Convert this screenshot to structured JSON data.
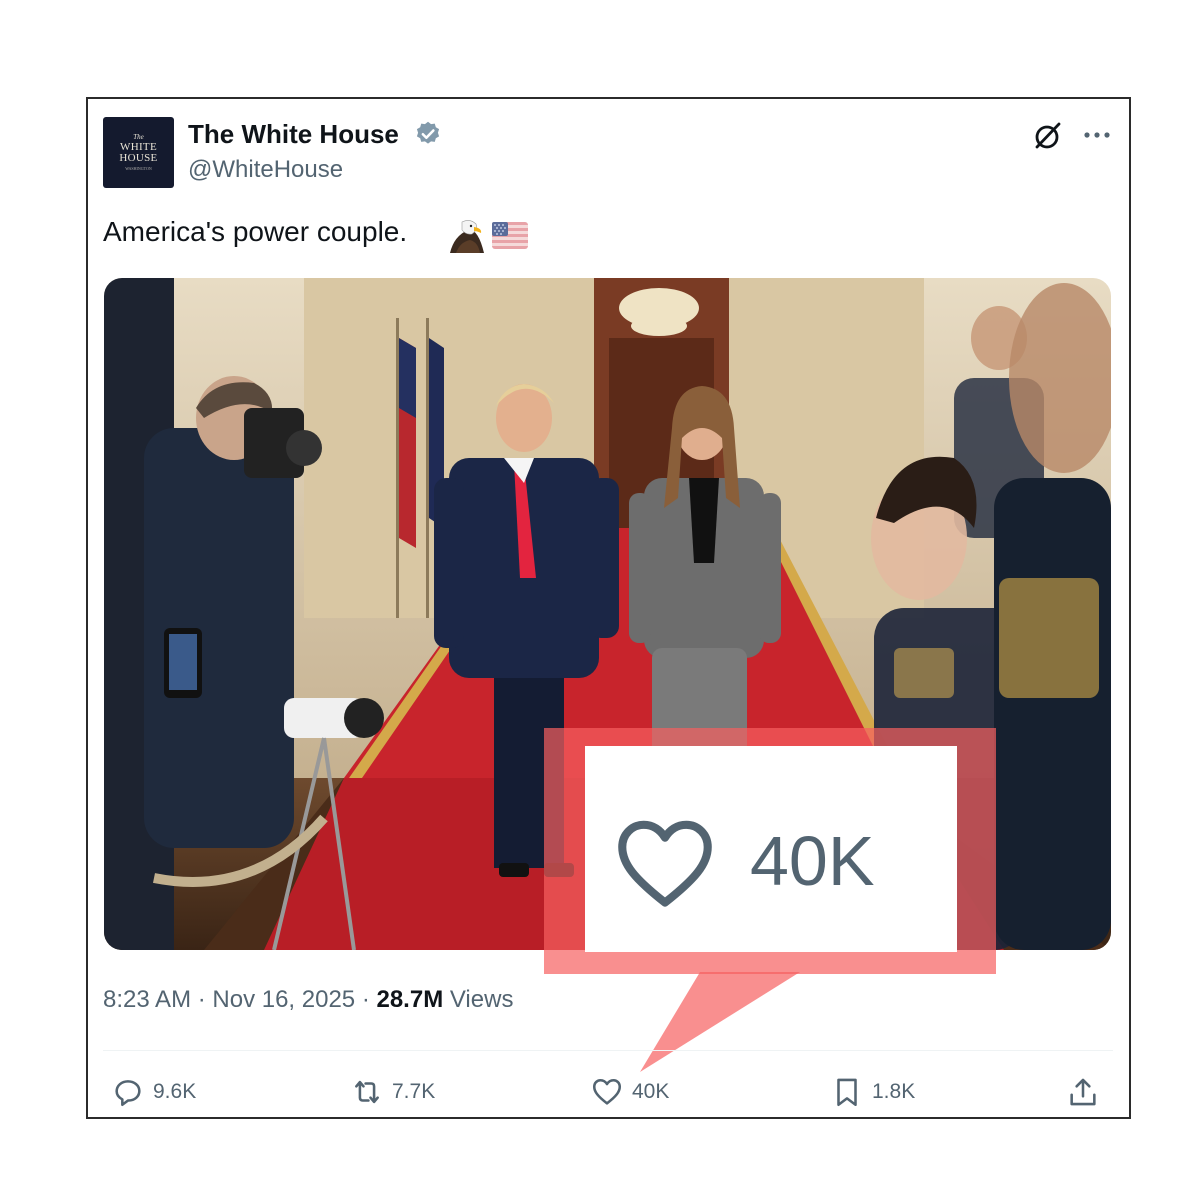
{
  "tweet": {
    "author": {
      "name": "The White House",
      "handle": "@WhiteHouse",
      "avatar_lines": [
        "The",
        "WHITE",
        "HOUSE",
        "WASHINGTON"
      ]
    },
    "text": "America's power couple.",
    "emojis": [
      "eagle-emoji",
      "us-flag-emoji"
    ],
    "timestamp": "8:23 AM · Nov 16, 2025 ·",
    "views_count": "28.7M",
    "views_label": "Views",
    "actions": {
      "reply": "9.6K",
      "retweet": "7.7K",
      "like": "40K",
      "bookmark": "1.8K"
    }
  },
  "callout": {
    "like_count": "40K",
    "color": "#f66060"
  },
  "colors": {
    "text_primary": "#0f1419",
    "text_secondary": "#536471",
    "verified_badge": "#829aab"
  },
  "icons": [
    "verified-badge-icon",
    "grok-icon",
    "more-icon",
    "reply-icon",
    "retweet-icon",
    "heart-icon",
    "bookmark-icon",
    "share-icon"
  ]
}
